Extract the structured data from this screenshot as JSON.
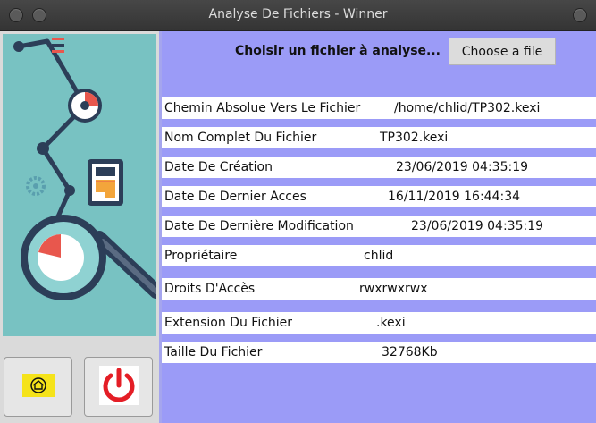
{
  "window": {
    "title": "Analyse De Fichiers - Winner"
  },
  "toolbar": {
    "choose_label": "Choisir un fichier à analyse...",
    "choose_button": "Choose a file"
  },
  "fields": [
    {
      "label": "Chemin Absolue Vers Le Fichier",
      "value": "/home/chlid/TP302.kexi"
    },
    {
      "label": "Nom Complet Du Fichier",
      "value": "TP302.kexi"
    },
    {
      "label": "Date De Création",
      "value": "23/06/2019 04:35:19"
    },
    {
      "label": "Date De Dernier Acces",
      "value": "16/11/2019 16:44:34"
    },
    {
      "label": "Date De Dernière Modification",
      "value": "23/06/2019 04:35:19"
    },
    {
      "label": "Propriétaire",
      "value": "chlid"
    },
    {
      "label": "Droits D'Accès",
      "value": "rwxrwxrwx"
    },
    {
      "label": "Extension Du Fichier",
      "value": ".kexi"
    },
    {
      "label": "Taille Du Fichier",
      "value": "32768Kb"
    }
  ],
  "icons": {
    "home": "home-icon",
    "power": "power-icon",
    "illustration": "file-analysis-illustration"
  },
  "colors": {
    "panel_bg": "#9b9bf7",
    "illustration_bg": "#78c2c2",
    "accent_red": "#e8574d",
    "power_red": "#e41e26"
  }
}
